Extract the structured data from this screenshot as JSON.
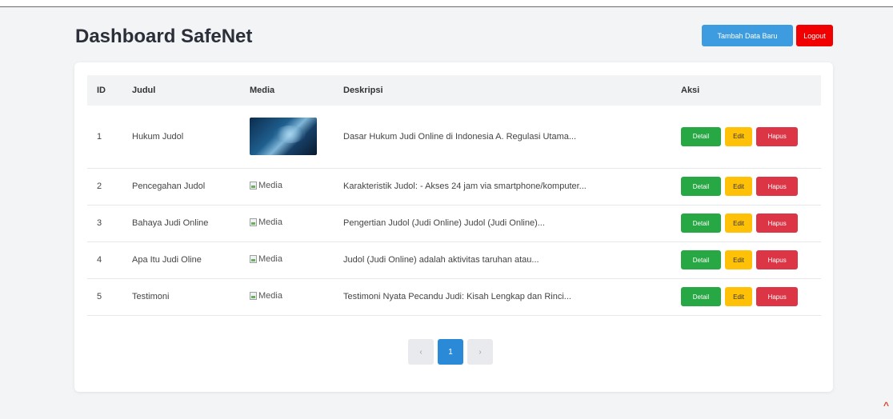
{
  "header": {
    "title": "Dashboard SafeNet",
    "add_label": "Tambah Data Baru",
    "logout_label": "Logout"
  },
  "table": {
    "columns": [
      "ID",
      "Judul",
      "Media",
      "Deskripsi",
      "Aksi"
    ],
    "rows": [
      {
        "id": "1",
        "judul": "Hukum Judol",
        "media": "image",
        "media_alt": "",
        "deskripsi": "Dasar Hukum Judi Online di Indonesia A. Regulasi Utama..."
      },
      {
        "id": "2",
        "judul": "Pencegahan Judol",
        "media": "broken",
        "media_alt": "Media",
        "deskripsi": "Karakteristik Judol: - Akses 24 jam via smartphone/komputer..."
      },
      {
        "id": "3",
        "judul": "Bahaya Judi Online",
        "media": "broken",
        "media_alt": "Media",
        "deskripsi": "Pengertian Judol (Judi Online) Judol (Judi Online)..."
      },
      {
        "id": "4",
        "judul": "Apa Itu Judi Oline",
        "media": "broken",
        "media_alt": "Media",
        "deskripsi": "Judol (Judi Online) adalah aktivitas taruhan atau..."
      },
      {
        "id": "5",
        "judul": "Testimoni",
        "media": "broken",
        "media_alt": "Media",
        "deskripsi": "Testimoni Nyata Pecandu Judi: Kisah Lengkap dan Rinci..."
      }
    ],
    "actions": {
      "detail": "Detail",
      "edit": "Edit",
      "hapus": "Hapus"
    }
  },
  "pagination": {
    "prev": "‹",
    "current": "1",
    "next": "›"
  },
  "icons": {
    "broken_image": "broken-image-icon",
    "scroll_top": "chevron-up-icon"
  },
  "colors": {
    "primary": "#3d9be0",
    "danger": "#f00000",
    "success": "#28a745",
    "warning": "#ffc107",
    "delete": "#dc3545",
    "page_active": "#2a8ad8"
  }
}
